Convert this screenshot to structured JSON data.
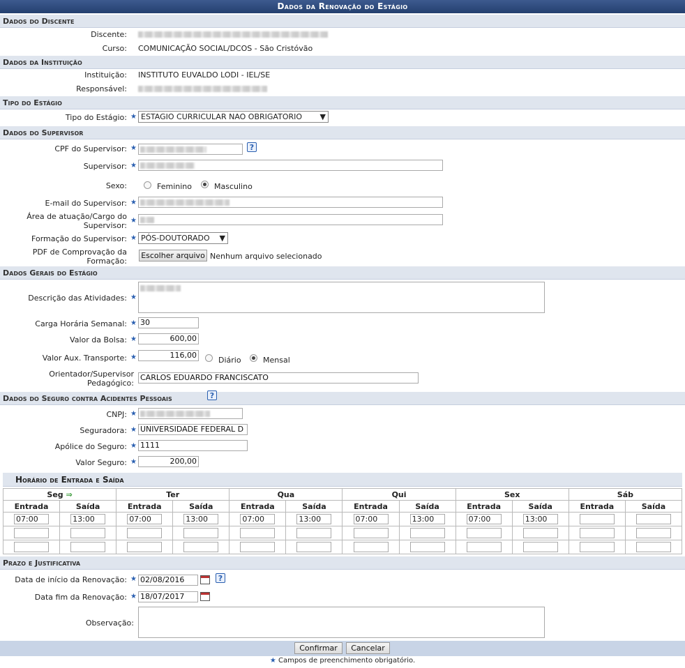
{
  "title": "Dados da Renovação do Estágio",
  "sections": {
    "discente": "Dados do Discente",
    "instituicao": "Dados da Instituição",
    "tipo": "Tipo do Estágio",
    "supervisor": "Dados do Supervisor",
    "gerais": "Dados Gerais do Estágio",
    "seguro": "Dados do Seguro contra Acidentes Pessoais",
    "horario": "Horário de Entrada e Saída",
    "prazo": "Prazo e Justificativa"
  },
  "discente": {
    "discente_label": "Discente:",
    "curso_label": "Curso:",
    "curso_value": "COMUNICAÇÃO SOCIAL/DCOS - São Cristóvão"
  },
  "instituicao": {
    "inst_label": "Instituição:",
    "inst_value": "INSTITUTO EUVALDO LODI - IEL/SE",
    "resp_label": "Responsável:"
  },
  "tipo": {
    "label": "Tipo do Estágio:",
    "value": "ESTAGIO CURRICULAR NAO OBRIGATORIO"
  },
  "supervisor": {
    "cpf_label": "CPF do Supervisor:",
    "nome_label": "Supervisor:",
    "sexo_label": "Sexo:",
    "sexo_options": [
      "Feminino",
      "Masculino"
    ],
    "sexo_selected": "Masculino",
    "email_label": "E-mail do Supervisor:",
    "area_label": "Área de atuação/Cargo do Supervisor:",
    "formacao_label": "Formação do Supervisor:",
    "formacao_value": "PÓS-DOUTORADO",
    "pdf_label": "PDF de Comprovação da Formação:",
    "file_button": "Escolher arquivo",
    "file_status": "Nenhum arquivo selecionado"
  },
  "gerais": {
    "descricao_label": "Descrição das Atividades:",
    "carga_label": "Carga Horária Semanal:",
    "carga_value": "30",
    "bolsa_label": "Valor da Bolsa:",
    "bolsa_value": "600,00",
    "transporte_label": "Valor Aux. Transporte:",
    "transporte_value": "116,00",
    "periodo_options": [
      "Diário",
      "Mensal"
    ],
    "periodo_selected": "Mensal",
    "orientador_label": "Orientador/Supervisor Pedagógico:",
    "orientador_value": "CARLOS EDUARDO FRANCISCATO"
  },
  "seguro": {
    "cnpj_label": "CNPJ:",
    "seguradora_label": "Seguradora:",
    "seguradora_value": "UNIVERSIDADE FEDERAL D",
    "apolice_label": "Apólice do Seguro:",
    "apolice_value": "1111",
    "valor_label": "Valor Seguro:",
    "valor_value": "200,00"
  },
  "horario": {
    "days": [
      "Seg",
      "Ter",
      "Qua",
      "Qui",
      "Sex",
      "Sáb"
    ],
    "sub": [
      "Entrada",
      "Saída"
    ],
    "rows": [
      [
        "07:00",
        "13:00",
        "07:00",
        "13:00",
        "07:00",
        "13:00",
        "07:00",
        "13:00",
        "07:00",
        "13:00",
        "",
        ""
      ],
      [
        "",
        "",
        "",
        "",
        "",
        "",
        "",
        "",
        "",
        "",
        "",
        ""
      ],
      [
        "",
        "",
        "",
        "",
        "",
        "",
        "",
        "",
        "",
        "",
        "",
        ""
      ]
    ]
  },
  "prazo": {
    "inicio_label": "Data de início da Renovação:",
    "inicio_value": "02/08/2016",
    "fim_label": "Data fim da Renovação:",
    "fim_value": "18/07/2017",
    "obs_label": "Observação:"
  },
  "actions": {
    "confirm": "Confirmar",
    "cancel": "Cancelar"
  },
  "footnote": "Campos de preenchimento obrigatório.",
  "colors": {
    "header": "#2f4a78",
    "section": "#dfe5ee",
    "required_star": "#2a5fb0"
  }
}
